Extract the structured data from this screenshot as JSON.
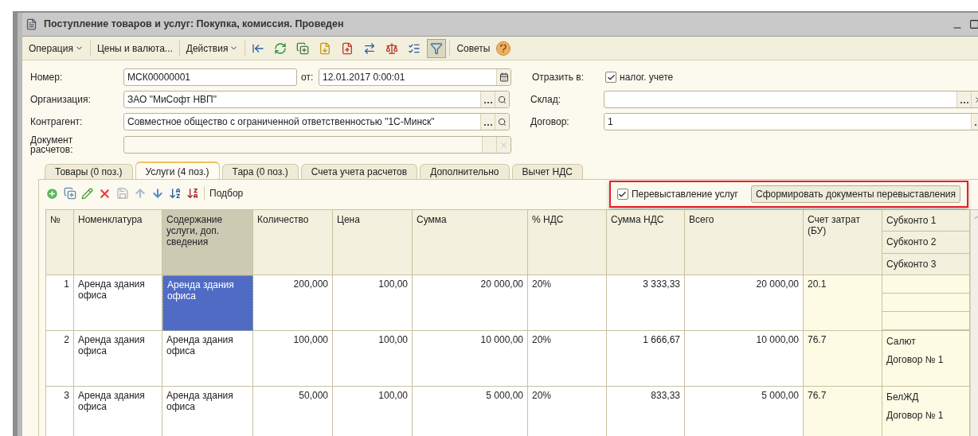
{
  "window": {
    "title": "Поступление товаров и услуг: Покупка, комиссия. Проведен"
  },
  "toolbar": {
    "menus": [
      {
        "label": "Операция",
        "dropdown": true
      },
      {
        "label": "Цены и валюта...",
        "dropdown": false
      },
      {
        "label": "Действия",
        "dropdown": true
      }
    ],
    "filter_toggle": {
      "pressed": true
    },
    "tips": "Советы"
  },
  "form": {
    "number": {
      "label": "Номер:",
      "value": "МСК00000001"
    },
    "date": {
      "label": "от:",
      "value": "12.01.2017  0:00:01"
    },
    "reflect": {
      "label": "Отразить в:",
      "option": "налог. учете",
      "checked": true
    },
    "organization": {
      "label": "Организация:",
      "value": "ЗАО \"МиСофт НВП\""
    },
    "warehouse": {
      "label": "Склад:"
    },
    "counterparty": {
      "label": "Контрагент:",
      "value": "Совместное общество с ограниченной ответственностью \"1С-Минск\""
    },
    "contract": {
      "label": "Договор:",
      "value": "1"
    },
    "settlement_doc": {
      "label": "Документ расчетов:",
      "disabled": true
    }
  },
  "tabs": [
    {
      "label": "Товары (0 поз.)",
      "selected": false
    },
    {
      "label": "Услуги (4 поз.)",
      "selected": true
    },
    {
      "label": "Тара (0 поз.)",
      "selected": false
    },
    {
      "label": "Счета учета расчетов",
      "selected": false
    },
    {
      "label": "Дополнительно",
      "selected": false
    },
    {
      "label": "Вычет НДС",
      "selected": false
    }
  ],
  "table_toolbar": {
    "pick": "Подбор",
    "reissue": {
      "label": "Перевыставление услуг",
      "checked": true
    },
    "reissue_button": "Сформировать документы перевыставления"
  },
  "table": {
    "columns": [
      "№",
      "Номенклатура",
      "Содержание услуги, доп. сведения",
      "Количество",
      "Цена",
      "Сумма",
      "% НДС",
      "Сумма НДС",
      "Всего",
      "Счет затрат (БУ)"
    ],
    "subkonto_columns": [
      "Субконто 1",
      "Субконто 2",
      "Субконто 3"
    ],
    "rows": [
      {
        "num": "1",
        "nomenclature": "Аренда здания офиса",
        "content": "Аренда здания офиса",
        "qty": "200,000",
        "price": "100,00",
        "sum": "20 000,00",
        "vat_rate": "20%",
        "vat_sum": "3 333,33",
        "total": "20 000,00",
        "account": "20.1",
        "subkonto": [],
        "selected": true
      },
      {
        "num": "2",
        "nomenclature": "Аренда здания офиса",
        "content": "Аренда здания офиса",
        "qty": "100,000",
        "price": "100,00",
        "sum": "10 000,00",
        "vat_rate": "20%",
        "vat_sum": "1 666,67",
        "total": "10 000,00",
        "account": "76.7",
        "subkonto": [
          "Салют",
          "Договор № 1"
        ],
        "selected": false
      },
      {
        "num": "3",
        "nomenclature": "Аренда здания офиса",
        "content": "Аренда здания офиса",
        "qty": "50,000",
        "price": "100,00",
        "sum": "5 000,00",
        "vat_rate": "20%",
        "vat_sum": "833,33",
        "total": "5 000,00",
        "account": "76.7",
        "subkonto": [
          "БелЖД",
          "Договор № 1"
        ],
        "selected": false
      }
    ]
  }
}
